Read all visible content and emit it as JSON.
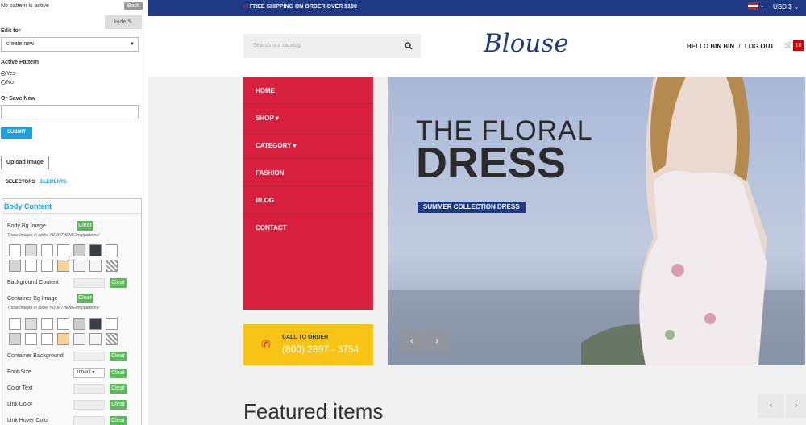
{
  "panel": {
    "status": "No pattern is active",
    "back": "Back",
    "hide": "Hide",
    "edit_for_label": "Edit for",
    "edit_for_value": "create new",
    "active_pattern_label": "Active Pattern",
    "yes": "Yes",
    "no": "No",
    "save_new_label": "Or Save New",
    "submit": "SUBMIT",
    "upload": "Upload Image",
    "tab_selectors": "SELECTORS",
    "tab_elements": "ELEMENTS",
    "section_title": "Body Content",
    "body_bg_image": "Body Bg Image",
    "clear": "Clear",
    "patterns_note": "Those Images in folder YOURTHEME/img/patterns/",
    "background_content": "Background Content",
    "container_bg_image": "Container Bg Image",
    "container_background": "Container Background",
    "font_size": "Font-Size",
    "font_size_value": "Inherit",
    "color_text": "Color Text",
    "link_color": "Link Color",
    "link_hover_color": "Link Hover Color"
  },
  "topbar": {
    "shipping": "FREE SHIPPING ON ORDER OVER $100",
    "currency": "USD $"
  },
  "header": {
    "search_placeholder": "Search our catalog",
    "logo": "Blouse",
    "user": "HELLO BIN BIN",
    "sep": "/",
    "logout": "LOG OUT",
    "cart_count": "10"
  },
  "menu": [
    "HOME",
    "SHOP",
    "CATEGORY",
    "FASHION",
    "BLOG",
    "CONTACT"
  ],
  "call": {
    "title": "CALL TO ORDER",
    "number": "(800) 2897 - 3754"
  },
  "hero": {
    "line1": "THE FLORAL",
    "line2": "DRESS",
    "tag": "SUMMER COLLECTION DRESS"
  },
  "featured": "Featured items",
  "colors": {
    "brand": "#1f3a85",
    "menu": "#d7203d",
    "call": "#f7c416",
    "accent": "#1ba1e2"
  }
}
